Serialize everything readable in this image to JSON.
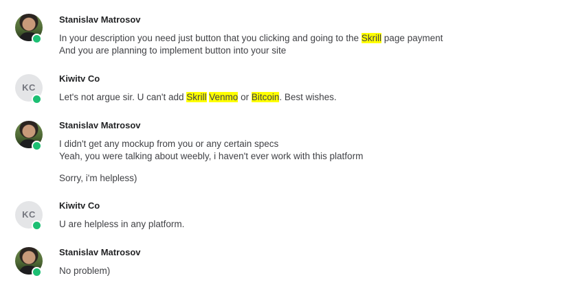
{
  "messages": [
    {
      "sender": "Stanislav Matrosov",
      "avatar": {
        "type": "photo",
        "online": true
      },
      "lines": [
        {
          "a": "In your description you need just button that you clicking and going to the ",
          "h1": "Skrill",
          "b": " page payment"
        },
        {
          "a": "And you are planning to implement button into your site"
        }
      ]
    },
    {
      "sender": "Kiwitv Co",
      "avatar": {
        "type": "initials",
        "initials": "KC",
        "online": true
      },
      "lines": [
        {
          "a": "Let's not argue sir. U can't add ",
          "h1": "Skrill",
          "s1": " ",
          "h2": "Venmo",
          "s2": " or ",
          "h3": "Bitcoin",
          "b": ". Best wishes."
        }
      ]
    },
    {
      "sender": "Stanislav Matrosov",
      "avatar": {
        "type": "photo",
        "online": true
      },
      "lines": [
        {
          "a": "I didn't get any mockup from you or any certain specs"
        },
        {
          "a": "Yeah, you were talking about weebly, i haven't ever work with this platform"
        },
        {
          "a": "Sorry, i'm helpless)"
        }
      ]
    },
    {
      "sender": "Kiwitv Co",
      "avatar": {
        "type": "initials",
        "initials": "KC",
        "online": true
      },
      "lines": [
        {
          "a": "U are helpless in any platform."
        }
      ]
    },
    {
      "sender": "Stanislav Matrosov",
      "avatar": {
        "type": "photo",
        "online": true
      },
      "lines": [
        {
          "a": "No problem)"
        }
      ]
    }
  ],
  "colors": {
    "highlight": "#ffff00",
    "online": "#1dbf73",
    "initials_bg": "#e4e5e7"
  }
}
